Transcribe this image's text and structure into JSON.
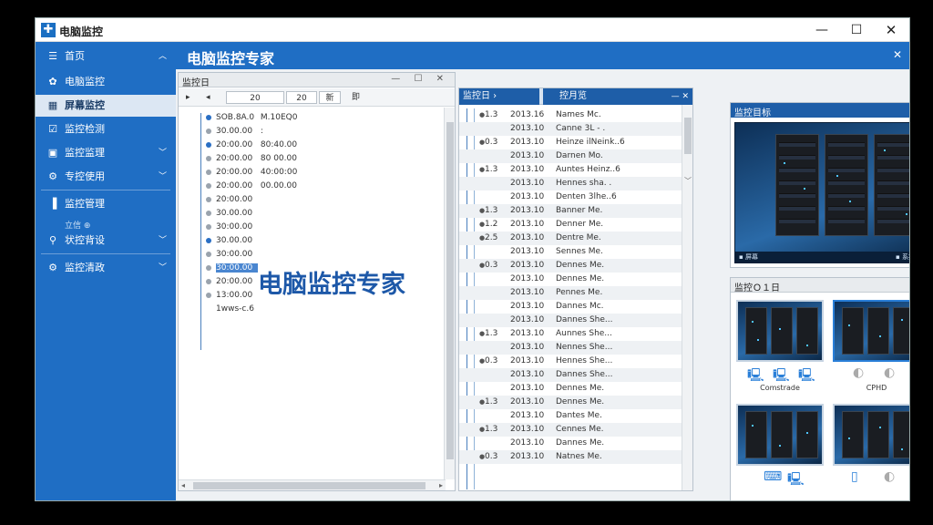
{
  "app": {
    "title": "电脑监控",
    "logo_glyph": "✚",
    "window_controls": {
      "minimize": "—",
      "maximize": "☐",
      "close": "✕"
    }
  },
  "sidebar": {
    "items": [
      {
        "label": "首页",
        "icon": "menu-icon",
        "glyph": "☰",
        "chevron": "︿"
      },
      {
        "label": "电脑监控",
        "icon": "gear-icon",
        "glyph": "✿",
        "chevron": ""
      },
      {
        "label": "屏幕监控",
        "icon": "grid-icon",
        "glyph": "▦",
        "chevron": ""
      },
      {
        "label": "监控检测",
        "icon": "check-icon",
        "glyph": "☑",
        "chevron": ""
      },
      {
        "label": "监控监理",
        "icon": "monitor-icon",
        "glyph": "▣",
        "chevron": "﹀"
      },
      {
        "label": "专控使用",
        "icon": "gear-icon",
        "glyph": "⚙",
        "chevron": "﹀"
      },
      {
        "label": "监控管理",
        "icon": "bar-chart-icon",
        "glyph": "▐",
        "chevron": ""
      },
      {
        "label": "状控背设",
        "icon": "pin-icon",
        "glyph": "⚲",
        "chevron": "﹀"
      },
      {
        "label": "监控清政",
        "icon": "gear-icon",
        "glyph": "⚙",
        "chevron": "﹀"
      }
    ],
    "small_label": "立信 ⊕"
  },
  "header": {
    "title": "电脑监控专家",
    "close": "✕"
  },
  "left_panel": {
    "title": "监控日",
    "controls": "— ☐ ✕",
    "toolbar": {
      "first": "▸",
      "prev": "◂",
      "page": "20",
      "total": "20",
      "action": "新",
      "last": "即"
    },
    "tree": [
      {
        "date": "SOB.8A.0",
        "time": "M.10EQ0"
      },
      {
        "date": "30.00.00",
        "time": ":"
      },
      {
        "date": "20:00.00",
        "time": "80:40.00"
      },
      {
        "date": "20:00.00",
        "time": "80 00.00"
      },
      {
        "date": "20:00.00",
        "time": "40:00:00"
      },
      {
        "date": "20:00.00",
        "time": "00.00.00"
      },
      {
        "date": "20:00.00",
        "time": ""
      },
      {
        "date": "30.00.00",
        "time": ""
      },
      {
        "date": "30:00.00",
        "time": ""
      },
      {
        "date": "30.00.00",
        "time": ""
      },
      {
        "date": "30:00.00",
        "time": ""
      },
      {
        "date": "30:00.00",
        "time": ""
      },
      {
        "date": "20:00.00",
        "time": ""
      },
      {
        "date": "13:00.00",
        "time": ""
      },
      {
        "date": "1wws-c.6",
        "time": ""
      }
    ],
    "watermark": "电脑监控专家"
  },
  "log_panel": {
    "tab1": "监控日 ›",
    "tab2": "控月览",
    "tab2_ctl": "— ✕",
    "rows": [
      {
        "ver": "1.3",
        "ts": "2013.16",
        "name": "Names Mc."
      },
      {
        "ver": "",
        "ts": "2013.10",
        "name": "Canne 3L - ."
      },
      {
        "ver": "0.3",
        "ts": "2013.10",
        "name": "Heinze ilNeink..6"
      },
      {
        "ver": "",
        "ts": "2013.10",
        "name": "Darnen Mo."
      },
      {
        "ver": "1.3",
        "ts": "2013.10",
        "name": "Auntes Heinz..6"
      },
      {
        "ver": "",
        "ts": "2013.10",
        "name": "Hennes sha. ."
      },
      {
        "ver": "",
        "ts": "2013.10",
        "name": "Denten 3lhe..6"
      },
      {
        "ver": "1.3",
        "ts": "2013.10",
        "name": "Banner Me."
      },
      {
        "ver": "1.2",
        "ts": "2013.10",
        "name": "Denner Me."
      },
      {
        "ver": "2.5",
        "ts": "2013.10",
        "name": "Dentre Me."
      },
      {
        "ver": "",
        "ts": "2013.10",
        "name": "Sennes Me."
      },
      {
        "ver": "0.3",
        "ts": "2013.10",
        "name": "Dennes Me."
      },
      {
        "ver": "",
        "ts": "2013.10",
        "name": "Dennes Me."
      },
      {
        "ver": "",
        "ts": "2013.10",
        "name": "Pennes Me."
      },
      {
        "ver": "",
        "ts": "2013.10",
        "name": "Dannes Mc."
      },
      {
        "ver": "",
        "ts": "2013.10",
        "name": "Dannes She..."
      },
      {
        "ver": "1.3",
        "ts": "2013.10",
        "name": "Aunnes She..."
      },
      {
        "ver": "",
        "ts": "2013.10",
        "name": "Nennes She..."
      },
      {
        "ver": "0.3",
        "ts": "2013.10",
        "name": "Hennes She..."
      },
      {
        "ver": "",
        "ts": "2013.10",
        "name": "Dannes She..."
      },
      {
        "ver": "",
        "ts": "2013.10",
        "name": "Dennes Me."
      },
      {
        "ver": "1.3",
        "ts": "2013.10",
        "name": "Dennes Me."
      },
      {
        "ver": "",
        "ts": "2013.10",
        "name": "Dantes Me."
      },
      {
        "ver": "1.3",
        "ts": "2013.10",
        "name": "Cennes Me."
      },
      {
        "ver": "",
        "ts": "2013.10",
        "name": "Dannes Me."
      },
      {
        "ver": "0.3",
        "ts": "2013.10",
        "name": "Natnes Me."
      }
    ]
  },
  "preview_panel": {
    "title": "监控目标",
    "controls": "—",
    "caption_left": "▪ 屏幕",
    "caption_right": "▪ 系控制"
  },
  "thumb_panel": {
    "title": "监控Ｏ１日",
    "controls": "— ☐ ✕",
    "labels": [
      "Comstrade",
      "CPHD"
    ]
  }
}
